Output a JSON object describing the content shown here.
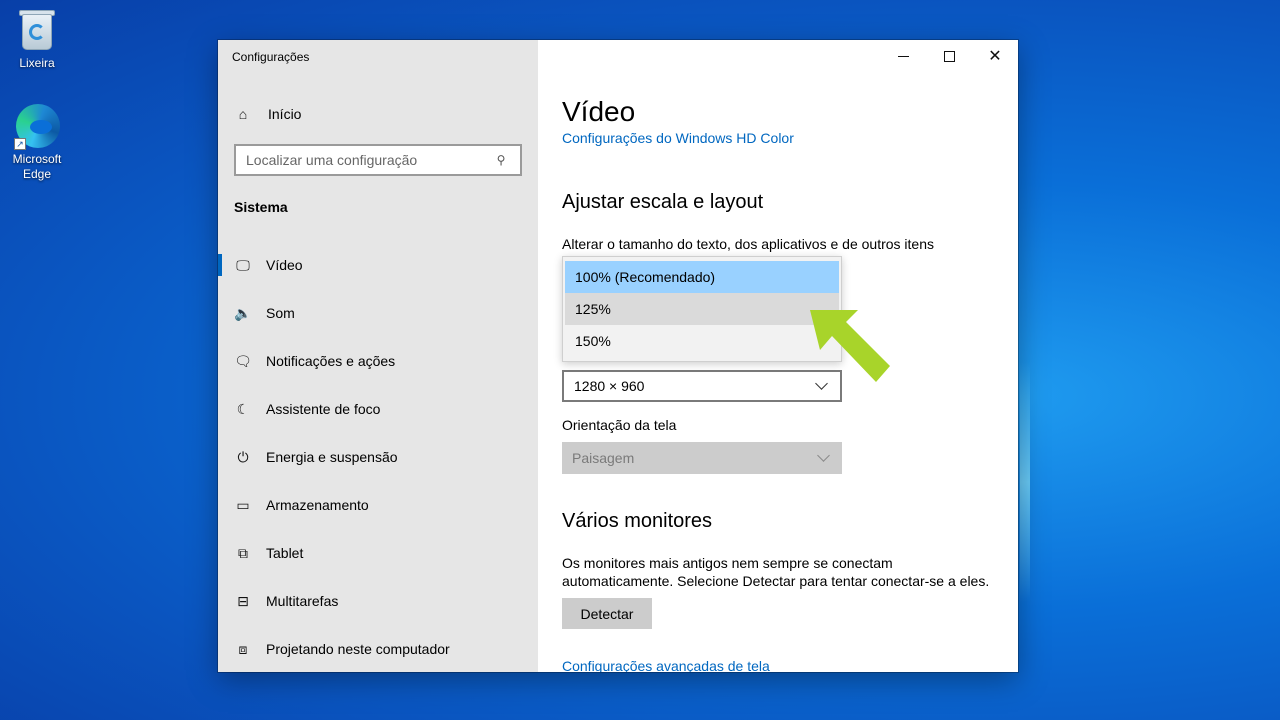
{
  "desktop": {
    "icons": [
      {
        "label": "Lixeira"
      },
      {
        "label_line1": "Microsoft",
        "label_line2": "Edge"
      }
    ]
  },
  "window": {
    "app_title": "Configurações",
    "controls": {
      "minimize": "minimize-icon",
      "maximize": "maximize-icon",
      "close": "✕"
    }
  },
  "sidebar": {
    "home_label": "Início",
    "search_placeholder": "Localizar uma configuração",
    "section_title": "Sistema",
    "items": [
      {
        "label": "Vídeo",
        "icon": "monitor-icon",
        "glyph": "🖵",
        "active": true
      },
      {
        "label": "Som",
        "icon": "speaker-icon",
        "glyph": "🔈"
      },
      {
        "label": "Notificações e ações",
        "icon": "notification-icon",
        "glyph": "🗨"
      },
      {
        "label": "Assistente de foco",
        "icon": "moon-icon",
        "glyph": "☾"
      },
      {
        "label": "Energia e suspensão",
        "icon": "power-icon",
        "glyph": "⏻"
      },
      {
        "label": "Armazenamento",
        "icon": "storage-icon",
        "glyph": "▭"
      },
      {
        "label": "Tablet",
        "icon": "tablet-icon",
        "glyph": "⧉"
      },
      {
        "label": "Multitarefas",
        "icon": "multitask-icon",
        "glyph": "⊟"
      },
      {
        "label": "Projetando neste computador",
        "icon": "projector-icon",
        "glyph": "⧈"
      }
    ]
  },
  "main": {
    "title": "Vídeo",
    "hd_color_link": "Configurações do Windows HD Color",
    "scale_heading": "Ajustar escala e layout",
    "text_size_label": "Alterar o tamanho do texto, dos aplicativos e de outros itens",
    "scale_options": [
      "100% (Recomendado)",
      "125%",
      "150%"
    ],
    "scale_selected": "100% (Recomendado)",
    "resolution_value": "1280 × 960",
    "orientation_label": "Orientação da tela",
    "orientation_value": "Paisagem",
    "multi_heading": "Vários monitores",
    "multi_desc": "Os monitores mais antigos nem sempre se conectam automaticamente. Selecione Detectar para tentar conectar-se a eles.",
    "detect_button": "Detectar",
    "advanced_link": "Configurações avançadas de tela"
  },
  "colors": {
    "accent": "#0067c0",
    "arrow": "#a8d42a",
    "selected_option": "#99d1ff"
  }
}
